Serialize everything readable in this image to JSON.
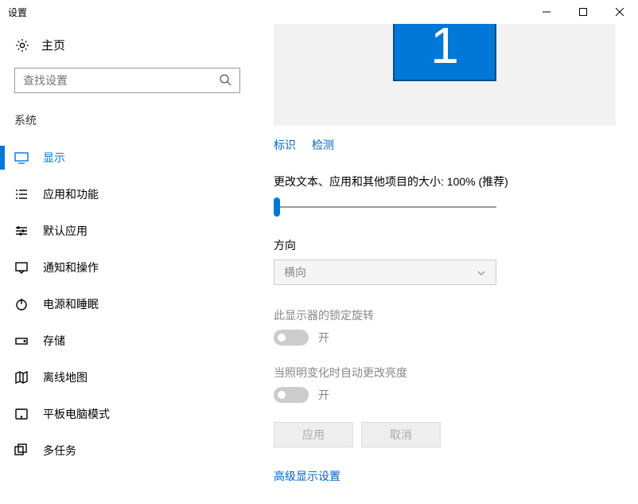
{
  "window": {
    "title": "设置"
  },
  "sidebar": {
    "home": "主页",
    "search_placeholder": "查找设置",
    "heading": "系统",
    "items": [
      {
        "label": "显示"
      },
      {
        "label": "应用和功能"
      },
      {
        "label": "默认应用"
      },
      {
        "label": "通知和操作"
      },
      {
        "label": "电源和睡眠"
      },
      {
        "label": "存储"
      },
      {
        "label": "离线地图"
      },
      {
        "label": "平板电脑模式"
      },
      {
        "label": "多任务"
      }
    ]
  },
  "main": {
    "monitor_number": "1",
    "identify": "标识",
    "detect": "检测",
    "scale_label": "更改文本、应用和其他项目的大小: 100% (推荐)",
    "orientation_heading": "方向",
    "orientation_value": "横向",
    "lock_rotation_label": "此显示器的锁定旋转",
    "lock_rotation_state": "开",
    "brightness_label": "当照明变化时自动更改亮度",
    "brightness_state": "开",
    "apply": "应用",
    "cancel": "取消",
    "advanced_link": "高级显示设置"
  }
}
